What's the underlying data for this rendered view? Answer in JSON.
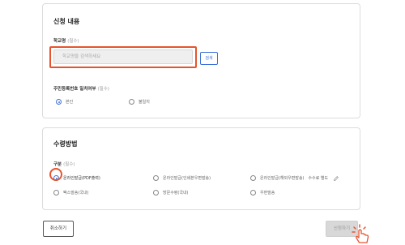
{
  "application": {
    "title": "신청 내용",
    "school_name": {
      "label": "학교명",
      "required": "(필수)",
      "placeholder": "학교명을 검색하세요",
      "button": "검색"
    },
    "identity": {
      "label": "주민등록번호 일치여부",
      "required": "(필수)",
      "options": [
        {
          "label": "본인",
          "checked": true
        },
        {
          "label": "불일치",
          "checked": false
        }
      ]
    }
  },
  "receive": {
    "title": "수령방법",
    "type_label": "구분",
    "type_required": "(필수)",
    "options": [
      {
        "label": "온라인발급(PDF출력)",
        "checked": true
      },
      {
        "label": "온라인발급(인쇄본우편발송)",
        "checked": false
      },
      {
        "label": "온라인발급(해외우편발송)",
        "checked": false
      },
      {
        "label": "팩스발송(국내)",
        "checked": false
      },
      {
        "label": "방문수령(국내)",
        "checked": false
      },
      {
        "label": "우편발송",
        "checked": false
      }
    ],
    "extra_note": "수수료 별도"
  },
  "buttons": {
    "cancel": "취소하기",
    "submit": "신청하기"
  },
  "colors": {
    "highlight": "#e8532e",
    "accent": "#3b72d9"
  }
}
